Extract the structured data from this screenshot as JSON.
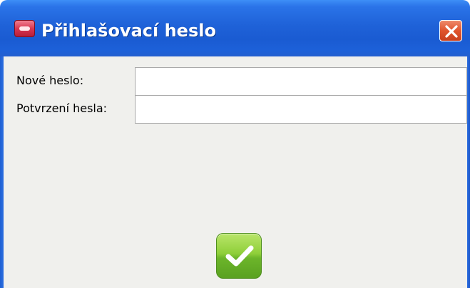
{
  "window": {
    "title": "Přihlašovací heslo",
    "icons": {
      "app": "app-icon",
      "close": "close-icon",
      "confirm": "checkmark-icon"
    }
  },
  "form": {
    "new_password_label": "Nové heslo:",
    "new_password_value": "",
    "confirm_password_label": "Potvrzení hesla:",
    "confirm_password_value": ""
  },
  "colors": {
    "titlebar": "#1f62d8",
    "close_button": "#e0542d",
    "ok_button": "#8fcf39",
    "client_background": "#f0f0ed"
  }
}
